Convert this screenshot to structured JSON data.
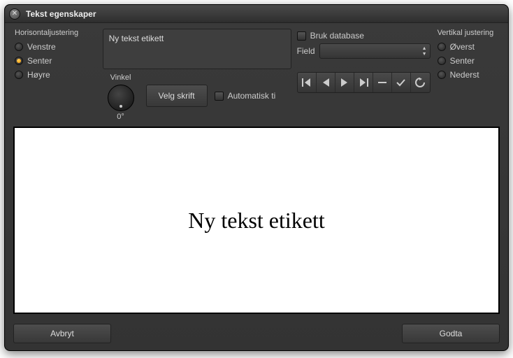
{
  "title": "Tekst egenskaper",
  "h_align": {
    "label": "Horisontaljustering",
    "options": {
      "left": "Venstre",
      "center": "Senter",
      "right": "Høyre"
    },
    "selected": "center"
  },
  "text_input": {
    "value": "Ny tekst etikett"
  },
  "angle": {
    "label": "Vinkel",
    "value": "0°"
  },
  "font_button": "Velg skrift",
  "auto_fit": {
    "label": "Automatisk ti",
    "checked": false
  },
  "db": {
    "use_label": "Bruk database",
    "use_checked": false,
    "field_label": "Field",
    "field_value": ""
  },
  "nav_icons": {
    "first": "first-icon",
    "prev": "prev-icon",
    "next": "next-icon",
    "last": "last-icon",
    "stop": "stop-icon",
    "apply": "check-icon",
    "refresh": "refresh-icon"
  },
  "v_align": {
    "label": "Vertikal justering",
    "options": {
      "top": "Øverst",
      "center": "Senter",
      "bottom": "Nederst"
    },
    "selected": ""
  },
  "preview_text": "Ny tekst etikett",
  "footer": {
    "cancel": "Avbryt",
    "accept": "Godta"
  }
}
